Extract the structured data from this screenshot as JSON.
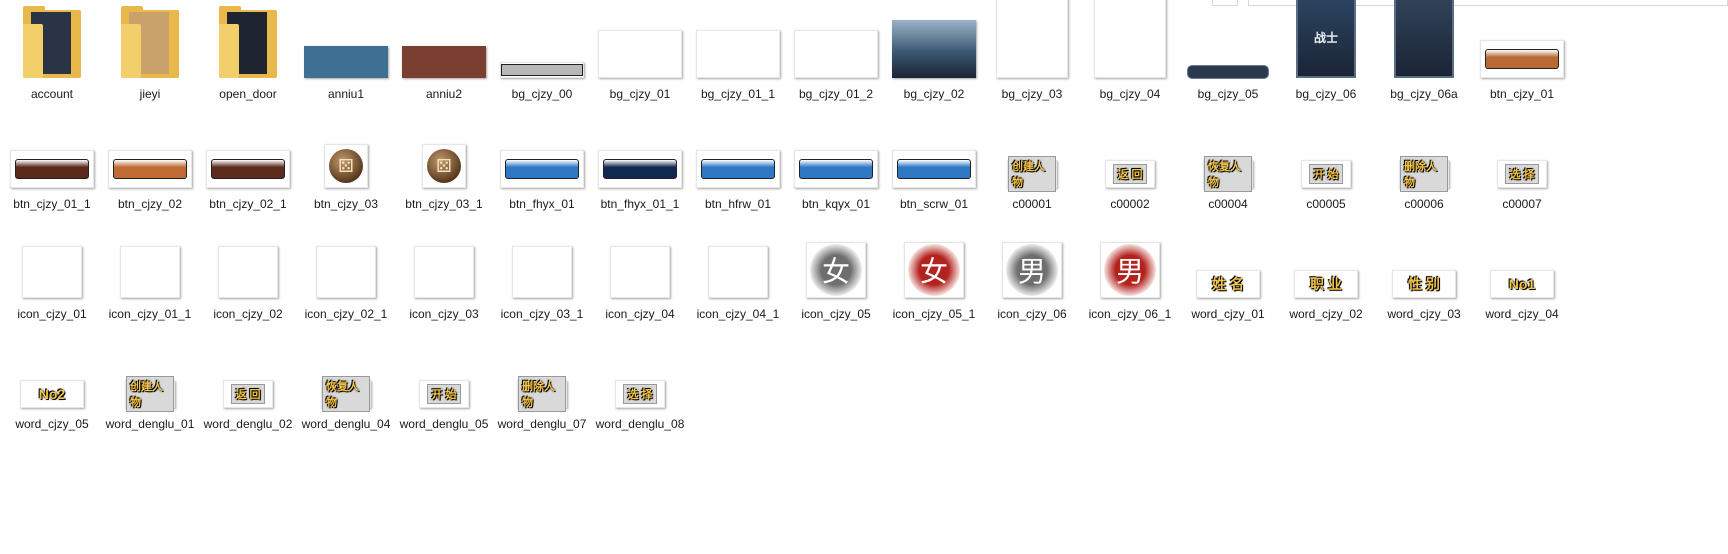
{
  "items": [
    {
      "label": "account",
      "kind": "folder",
      "paper": "#2b3444"
    },
    {
      "label": "jieyi",
      "kind": "folder",
      "paper": "#c8a16b"
    },
    {
      "label": "open_door",
      "kind": "folder",
      "paper": "#1f2530"
    },
    {
      "label": "anniu1",
      "kind": "bar",
      "color": "#3f6f93"
    },
    {
      "label": "anniu2",
      "kind": "bar",
      "color": "#7a3f30"
    },
    {
      "label": "bg_cjzy_00",
      "kind": "thinbar",
      "color": "#b8b8b8"
    },
    {
      "label": "bg_cjzy_01",
      "kind": "blank-wide"
    },
    {
      "label": "bg_cjzy_01_1",
      "kind": "blank-wide"
    },
    {
      "label": "bg_cjzy_01_2",
      "kind": "blank-wide"
    },
    {
      "label": "bg_cjzy_02",
      "kind": "photo",
      "color": "#3b5874"
    },
    {
      "label": "bg_cjzy_03",
      "kind": "blank-tall"
    },
    {
      "label": "bg_cjzy_04",
      "kind": "blank-tall"
    },
    {
      "label": "bg_cjzy_05",
      "kind": "slimbar",
      "color": "#2c3a4d"
    },
    {
      "label": "bg_cjzy_06",
      "kind": "card",
      "color": "#2c4461",
      "text": "战士"
    },
    {
      "label": "bg_cjzy_06a",
      "kind": "card",
      "color": "#314359",
      "text": ""
    },
    {
      "label": "btn_cjzy_01",
      "kind": "btn",
      "color": "#b86a35"
    },
    {
      "label": "btn_cjzy_01_1",
      "kind": "btn",
      "color": "#5b2a1a"
    },
    {
      "label": "btn_cjzy_02",
      "kind": "btn",
      "color": "#c06b34"
    },
    {
      "label": "btn_cjzy_02_1",
      "kind": "btn",
      "color": "#5c2b1b"
    },
    {
      "label": "btn_cjzy_03",
      "kind": "dice"
    },
    {
      "label": "btn_cjzy_03_1",
      "kind": "dice"
    },
    {
      "label": "btn_fhyx_01",
      "kind": "btn",
      "color": "#2f79c4"
    },
    {
      "label": "btn_fhyx_01_1",
      "kind": "btn",
      "color": "#122a52"
    },
    {
      "label": "btn_hfrw_01",
      "kind": "btn",
      "color": "#2f79c4"
    },
    {
      "label": "btn_kqyx_01",
      "kind": "btn",
      "color": "#2f79c4"
    },
    {
      "label": "btn_scrw_01",
      "kind": "btn",
      "color": "#2f79c4"
    },
    {
      "label": "c00001",
      "kind": "smalltext",
      "text": "创建人物"
    },
    {
      "label": "c00002",
      "kind": "smalltext",
      "text": "返 回"
    },
    {
      "label": "c00004",
      "kind": "smalltext",
      "text": "恢复人物"
    },
    {
      "label": "c00005",
      "kind": "smalltext",
      "text": "开 始"
    },
    {
      "label": "c00006",
      "kind": "smalltext",
      "text": "删除人物"
    },
    {
      "label": "c00007",
      "kind": "smalltext",
      "text": "选 择"
    },
    {
      "label": "icon_cjzy_01",
      "kind": "blank-square"
    },
    {
      "label": "icon_cjzy_01_1",
      "kind": "blank-square"
    },
    {
      "label": "icon_cjzy_02",
      "kind": "blank-square"
    },
    {
      "label": "icon_cjzy_02_1",
      "kind": "blank-square"
    },
    {
      "label": "icon_cjzy_03",
      "kind": "blank-square"
    },
    {
      "label": "icon_cjzy_03_1",
      "kind": "blank-square"
    },
    {
      "label": "icon_cjzy_04",
      "kind": "blank-square"
    },
    {
      "label": "icon_cjzy_04_1",
      "kind": "blank-square"
    },
    {
      "label": "icon_cjzy_05",
      "kind": "glyph",
      "text": "女",
      "color": "#6e6e6e"
    },
    {
      "label": "icon_cjzy_05_1",
      "kind": "glyph",
      "text": "女",
      "color": "#b3221c"
    },
    {
      "label": "icon_cjzy_06",
      "kind": "glyph",
      "text": "男",
      "color": "#6e6e6e"
    },
    {
      "label": "icon_cjzy_06_1",
      "kind": "glyph",
      "text": "男",
      "color": "#b3221c"
    },
    {
      "label": "word_cjzy_01",
      "kind": "word",
      "text": "姓 名"
    },
    {
      "label": "word_cjzy_02",
      "kind": "word",
      "text": "职 业"
    },
    {
      "label": "word_cjzy_03",
      "kind": "word",
      "text": "性 别"
    },
    {
      "label": "word_cjzy_04",
      "kind": "word",
      "text": "No1"
    },
    {
      "label": "word_cjzy_05",
      "kind": "word",
      "text": "No2"
    },
    {
      "label": "word_denglu_01",
      "kind": "smalltext",
      "text": "创建人物"
    },
    {
      "label": "word_denglu_02",
      "kind": "smalltext",
      "text": "返 回"
    },
    {
      "label": "word_denglu_04",
      "kind": "smalltext",
      "text": "恢复人物"
    },
    {
      "label": "word_denglu_05",
      "kind": "smalltext",
      "text": "开 始"
    },
    {
      "label": "word_denglu_07",
      "kind": "smalltext",
      "text": "删除人物"
    },
    {
      "label": "word_denglu_08",
      "kind": "smalltext",
      "text": "选 择"
    }
  ]
}
